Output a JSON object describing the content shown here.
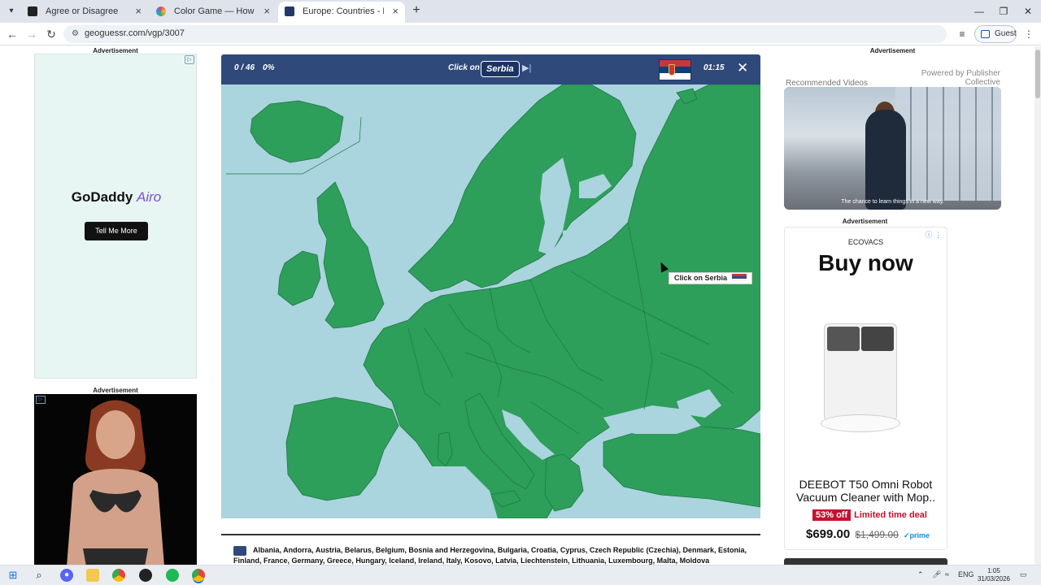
{
  "browser": {
    "tabs": [
      {
        "title": "Agree or Disagree",
        "active": false,
        "favicon_color": "#222222"
      },
      {
        "title": "Color Game — How Well Can Y",
        "active": false,
        "favicon_color": "#e9426b"
      },
      {
        "title": "Europe: Countries - Map Quiz",
        "active": true,
        "favicon_color": "#1f3a64"
      }
    ],
    "url": "geoguessr.com/vgp/3007",
    "guest_label": "Guest"
  },
  "ads": {
    "label": "Advertisement",
    "godaddy_brand": "GoDaddy",
    "godaddy_product": "Airo",
    "godaddy_button": "Tell Me More",
    "powered_by": "Powered by Publisher Collective",
    "recommended_videos": "Recommended Videos",
    "video_caption": "The chance to learn things in a new way.",
    "ecovacs_brand": "ECOVACS",
    "ecovacs_headline": "Buy now",
    "ecovacs_product": "DEEBOT T50 Omni Robot Vacuum Cleaner with Mop..",
    "ecovacs_discount": "53% off",
    "ecovacs_deal": "Limited time deal",
    "ecovacs_price": "$699.00",
    "ecovacs_old_price": "$1,499.00",
    "ecovacs_prime": "✓prime"
  },
  "quiz": {
    "progress": "0 / 46",
    "percent": "0%",
    "prompt_prefix": "Click on",
    "target": "Serbia",
    "timer": "01:15",
    "tooltip": "Click on Serbia",
    "flag_colors": [
      "#c6363c",
      "#0c4076",
      "#ffffff"
    ],
    "countries_list": "Albania, Andorra, Austria, Belarus, Belgium, Bosnia and Herzegovina, Bulgaria, Croatia, Cyprus, Czech Republic (Czechia), Denmark, Estonia, Finland, France, Germany, Greece, Hungary, Iceland, Ireland, Italy, Kosovo, Latvia, Liechtenstein, Lithuania, Luxembourg, Malta, Moldova"
  },
  "taskbar": {
    "language": "ENG",
    "time": "1:05",
    "date": "31/03/2026"
  },
  "colors": {
    "quiz_header": "#2f4a7a",
    "land": "#2e9e5b",
    "sea": "#aad4de"
  }
}
